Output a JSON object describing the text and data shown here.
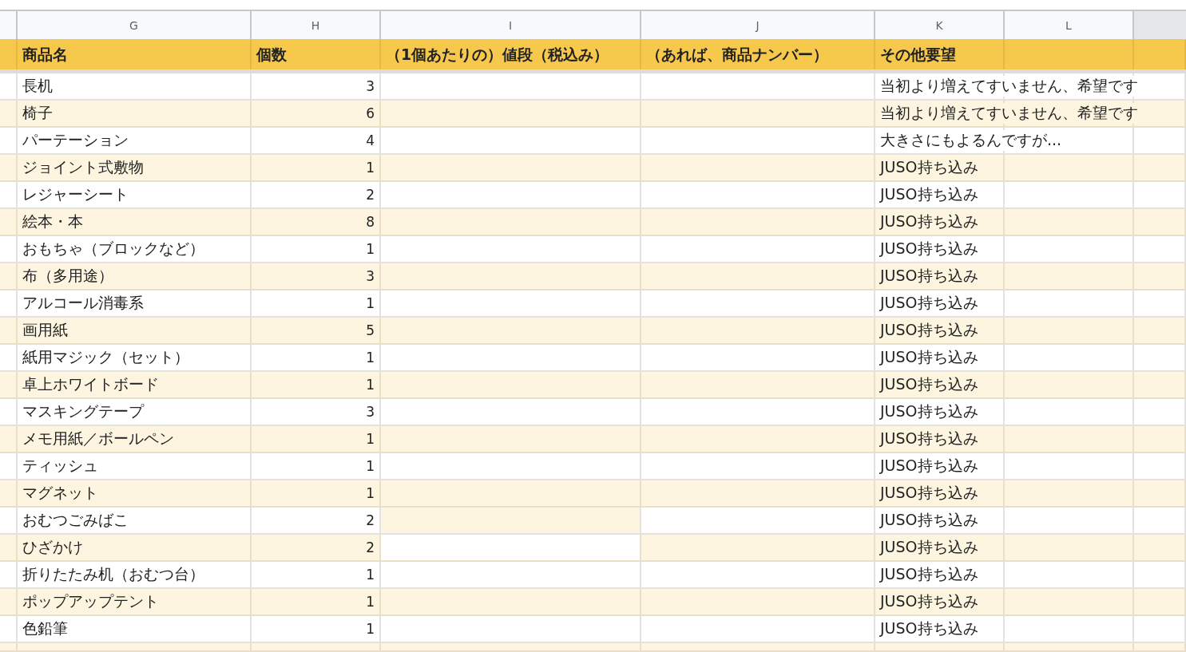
{
  "column_letters": [
    "G",
    "H",
    "I",
    "J",
    "K",
    "L"
  ],
  "headers": [
    "商品名",
    "個数",
    "（1個あたりの）値段（税込み）",
    "（あれば、商品ナンバー）",
    "その他要望"
  ],
  "rows": [
    {
      "name": "長机",
      "quantity": "3",
      "note": "当初より増えてすいません、希望です",
      "shaded": false,
      "price_shaded": false
    },
    {
      "name": "椅子",
      "quantity": "6",
      "note": "当初より増えてすいません、希望です",
      "shaded": true,
      "price_shaded": true
    },
    {
      "name": "パーテーション",
      "quantity": "4",
      "note": "大きさにもよるんですが...",
      "shaded": false,
      "price_shaded": false
    },
    {
      "name": "ジョイント式敷物",
      "quantity": "1",
      "note": "JUSO持ち込み",
      "shaded": true,
      "price_shaded": true
    },
    {
      "name": "レジャーシート",
      "quantity": "2",
      "note": "JUSO持ち込み",
      "shaded": false,
      "price_shaded": false
    },
    {
      "name": "絵本・本",
      "quantity": "8",
      "note": "JUSO持ち込み",
      "shaded": true,
      "price_shaded": true
    },
    {
      "name": "おもちゃ（ブロックなど）",
      "quantity": "1",
      "note": "JUSO持ち込み",
      "shaded": false,
      "price_shaded": false
    },
    {
      "name": "布（多用途）",
      "quantity": "3",
      "note": "JUSO持ち込み",
      "shaded": true,
      "price_shaded": true
    },
    {
      "name": "アルコール消毒系",
      "quantity": "1",
      "note": "JUSO持ち込み",
      "shaded": false,
      "price_shaded": false
    },
    {
      "name": "画用紙",
      "quantity": "5",
      "note": "JUSO持ち込み",
      "shaded": true,
      "price_shaded": true
    },
    {
      "name": "紙用マジック（セット）",
      "quantity": "1",
      "note": "JUSO持ち込み",
      "shaded": false,
      "price_shaded": false
    },
    {
      "name": "卓上ホワイトボード",
      "quantity": "1",
      "note": "JUSO持ち込み",
      "shaded": true,
      "price_shaded": true
    },
    {
      "name": "マスキングテープ",
      "quantity": "3",
      "note": "JUSO持ち込み",
      "shaded": false,
      "price_shaded": false
    },
    {
      "name": "メモ用紙／ボールペン",
      "quantity": "1",
      "note": "JUSO持ち込み",
      "shaded": true,
      "price_shaded": true
    },
    {
      "name": "ティッシュ",
      "quantity": "1",
      "note": "JUSO持ち込み",
      "shaded": false,
      "price_shaded": false
    },
    {
      "name": "マグネット",
      "quantity": "1",
      "note": "JUSO持ち込み",
      "shaded": true,
      "price_shaded": true
    },
    {
      "name": "おむつごみばこ",
      "quantity": "2",
      "note": "JUSO持ち込み",
      "shaded": false,
      "price_shaded": true
    },
    {
      "name": "ひざかけ",
      "quantity": "2",
      "note": "JUSO持ち込み",
      "shaded": true,
      "price_shaded": false
    },
    {
      "name": "折りたたみ机（おむつ台）",
      "quantity": "1",
      "note": "JUSO持ち込み",
      "shaded": false,
      "price_shaded": false
    },
    {
      "name": "ポップアップテント",
      "quantity": "1",
      "note": "JUSO持ち込み",
      "shaded": true,
      "price_shaded": true
    },
    {
      "name": "色鉛筆",
      "quantity": "1",
      "note": "JUSO持ち込み",
      "shaded": false,
      "price_shaded": false
    }
  ]
}
